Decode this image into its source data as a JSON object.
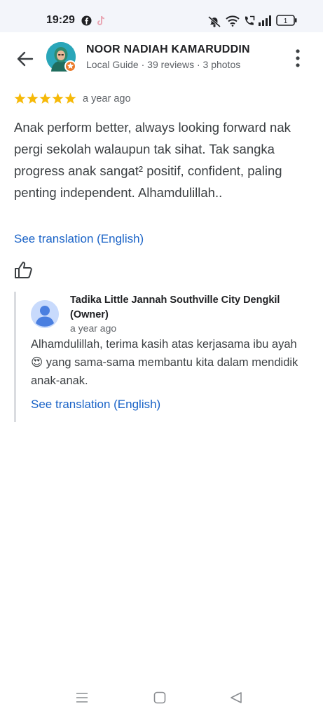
{
  "status_bar": {
    "time": "19:29",
    "icons": [
      "facebook-icon",
      "tiktok-icon",
      "mute-icon",
      "wifi-icon",
      "call-icon",
      "signal-icon",
      "battery-icon"
    ],
    "battery_label": "1"
  },
  "header": {
    "reviewer_name": "NOOR NADIAH KAMARUDDIN",
    "reviewer_meta": "Local Guide · 39 reviews · 3 photos"
  },
  "review": {
    "rating": 5,
    "max_rating": 5,
    "date": "a year ago",
    "text": "Anak perform better, always looking forward nak pergi sekolah walaupun tak sihat. Tak sangka progress anak sangat² positif, confident, paling penting independent. Alhamdulillah..",
    "translate_label": "See translation (English)"
  },
  "owner_reply": {
    "name": "Tadika Little Jannah Southville City Dengkil (Owner)",
    "date": "a year ago",
    "text": "Alhamdulillah, terima kasih atas kerjasama ibu ayah 😍 yang sama-sama membantu kita dalam mendidik anak-anak.",
    "translate_label": "See translation (English)"
  },
  "colors": {
    "star": "#f6b908",
    "link": "#1a63c7",
    "badge": "#ea7a2a"
  }
}
